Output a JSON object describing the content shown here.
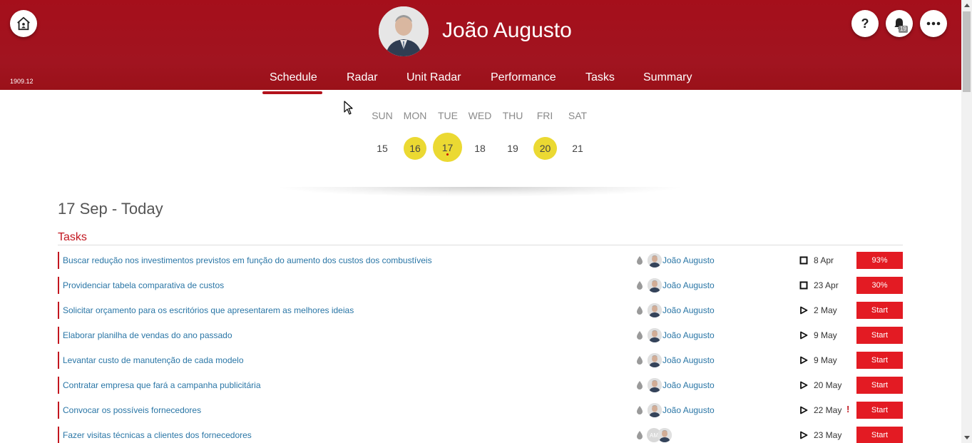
{
  "header": {
    "user_name": "João Augusto",
    "version": "1909.12",
    "help_label": "?",
    "notification_count": "19",
    "nav": [
      {
        "label": "Schedule",
        "active": true
      },
      {
        "label": "Radar"
      },
      {
        "label": "Unit Radar"
      },
      {
        "label": "Performance"
      },
      {
        "label": "Tasks"
      },
      {
        "label": "Summary"
      }
    ]
  },
  "calendar": {
    "weekdays": [
      "SUN",
      "MON",
      "TUE",
      "WED",
      "THU",
      "FRI",
      "SAT"
    ],
    "days": [
      {
        "num": "15",
        "highlight": false
      },
      {
        "num": "16",
        "highlight": true
      },
      {
        "num": "17",
        "highlight": true,
        "today": true
      },
      {
        "num": "18",
        "highlight": false
      },
      {
        "num": "19",
        "highlight": false
      },
      {
        "num": "20",
        "highlight": true
      },
      {
        "num": "21",
        "highlight": false
      }
    ],
    "highlight_color": "#ebd932"
  },
  "main": {
    "date_title": "17 Sep - Today",
    "section_title": "Tasks",
    "tasks": [
      {
        "title": "Buscar redução nos investimentos previstos em função do aumento dos custos dos combustíveis",
        "assignee": "João Augusto",
        "status_icon": "square-icon",
        "due": "8 Apr",
        "action": "93%",
        "alert": ""
      },
      {
        "title": "Providenciar tabela comparativa de custos",
        "assignee": "João Augusto",
        "status_icon": "square-icon",
        "due": "23 Apr",
        "action": "30%",
        "alert": ""
      },
      {
        "title": "Solicitar orçamento para os escritórios que apresentarem as melhores ideias",
        "assignee": "João Augusto",
        "status_icon": "play-icon",
        "due": "2 May",
        "action": "Start",
        "alert": ""
      },
      {
        "title": "Elaborar planilha de vendas do ano passado",
        "assignee": "João Augusto",
        "status_icon": "play-icon",
        "due": "9 May",
        "action": "Start",
        "alert": ""
      },
      {
        "title": "Levantar custo de manutenção de cada modelo",
        "assignee": "João Augusto",
        "status_icon": "play-icon",
        "due": "9 May",
        "action": "Start",
        "alert": ""
      },
      {
        "title": "Contratar empresa que fará a campanha publicitária",
        "assignee": "João Augusto",
        "status_icon": "play-icon",
        "due": "20 May",
        "action": "Start",
        "alert": ""
      },
      {
        "title": "Convocar os possíveis fornecedores",
        "assignee": "João Augusto",
        "status_icon": "play-icon",
        "due": "22 May",
        "action": "Start",
        "alert": "!"
      },
      {
        "title": "Fazer visitas técnicas a clientes dos fornecedores",
        "assignee": "",
        "initials": "AM",
        "status_icon": "play-icon",
        "due": "23 May",
        "action": "Start",
        "alert": ""
      }
    ]
  },
  "colors": {
    "header_red": "#a50f1b",
    "accent_red": "#e31b23",
    "link_blue": "#2a76a6"
  }
}
